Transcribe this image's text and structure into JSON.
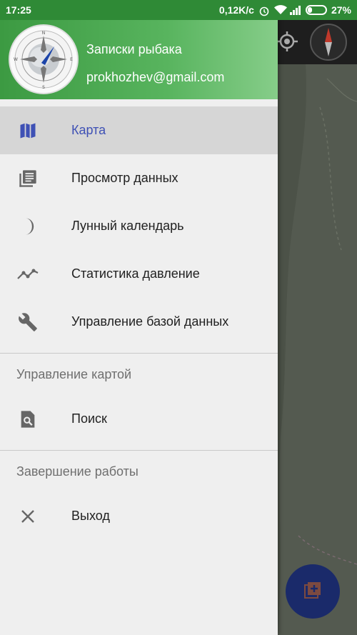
{
  "status_bar": {
    "time": "17:25",
    "speed": "0,12K/c",
    "battery": "27%"
  },
  "header": {
    "title": "Записки рыбака",
    "email": "prokhozhev@gmail.com"
  },
  "menu_main": [
    {
      "label": "Карта",
      "icon": "map-icon",
      "active": true
    },
    {
      "label": "Просмотр данных",
      "icon": "library-books-icon",
      "active": false
    },
    {
      "label": "Лунный календарь",
      "icon": "moon-icon",
      "active": false
    },
    {
      "label": "Статистика давление",
      "icon": "trending-line-icon",
      "active": false
    },
    {
      "label": "Управление базой данных",
      "icon": "wrench-icon",
      "active": false
    }
  ],
  "section_map": {
    "title": "Управление картой",
    "items": [
      {
        "label": "Поиск",
        "icon": "search-file-icon"
      }
    ]
  },
  "section_exit": {
    "title": "Завершение работы",
    "items": [
      {
        "label": "Выход",
        "icon": "close-icon"
      }
    ]
  },
  "colors": {
    "accent": "#3f51b5",
    "header_green": "#3c9a42",
    "status_green": "#2f8a36"
  }
}
